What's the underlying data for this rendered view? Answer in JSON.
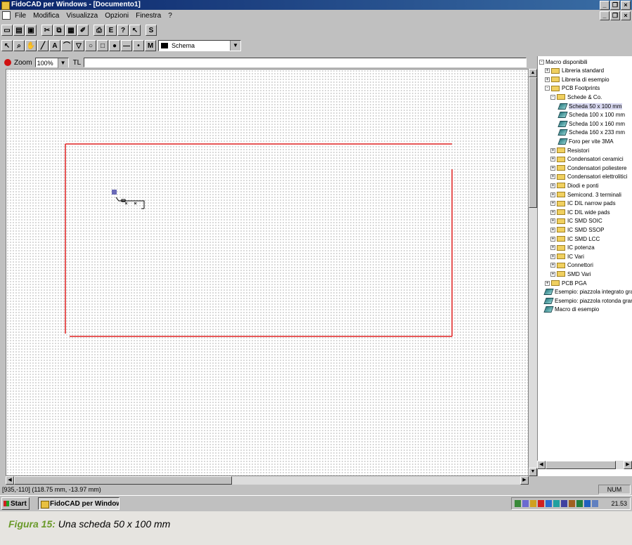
{
  "window": {
    "title": "FidoCAD per Windows - [Documento1]"
  },
  "menu": {
    "items": [
      "File",
      "Modifica",
      "Visualizza",
      "Opzioni",
      "Finestra",
      "?"
    ]
  },
  "toolbar1": {
    "buttons": [
      "new-icon",
      "open-icon",
      "save-icon",
      "cut-icon",
      "copy-icon",
      "paste-icon",
      "eraser-icon",
      "print-icon",
      "export-icon",
      "help-icon",
      "context-help-icon",
      "S"
    ]
  },
  "toolbar2": {
    "buttons": [
      "select-arrow-icon",
      "zoom-magnifier-icon",
      "hand-pan-icon",
      "line-icon",
      "A",
      "curve-icon",
      "polygon-icon",
      "ellipse-icon",
      "rectangle-icon",
      "dot-icon",
      "line-segment-icon",
      "pad-icon",
      "M"
    ],
    "layer": {
      "label": "Schema",
      "color": "#000000"
    }
  },
  "zoombar": {
    "zoom_label": "Zoom",
    "zoom_value": "100%",
    "text_label": "TL",
    "text_value": ""
  },
  "colors": {
    "outline": "#e02020",
    "canvas_dot": "#a8a8a8"
  },
  "tree": {
    "root": "Macro disponibili",
    "nodes": [
      {
        "label": "Libreria standard",
        "type": "folder",
        "expander": "+"
      },
      {
        "label": "Libreria di esempio",
        "type": "folder",
        "expander": "+"
      },
      {
        "label": "PCB Footprints",
        "type": "folder",
        "expander": "-"
      },
      {
        "label": "Schede & Co.",
        "type": "folder",
        "expander": "-"
      },
      {
        "label": "Scheda  50 x 100 mm",
        "type": "macro",
        "selected": true
      },
      {
        "label": "Scheda 100 x 100 mm",
        "type": "macro"
      },
      {
        "label": "Scheda 100 x 160 mm",
        "type": "macro"
      },
      {
        "label": "Scheda 160 x 233 mm",
        "type": "macro"
      },
      {
        "label": "Foro per vite 3MA",
        "type": "macro"
      },
      {
        "label": "Resistori",
        "type": "folder",
        "expander": "+"
      },
      {
        "label": "Condensatori ceramici",
        "type": "folder",
        "expander": "+"
      },
      {
        "label": "Condensatori poliestere",
        "type": "folder",
        "expander": "+"
      },
      {
        "label": "Condensatori elettrolitici",
        "type": "folder",
        "expander": "+"
      },
      {
        "label": "Diodi e ponti",
        "type": "folder",
        "expander": "+"
      },
      {
        "label": "Semicond. 3 terminali",
        "type": "folder",
        "expander": "+"
      },
      {
        "label": "IC DIL narrow pads",
        "type": "folder",
        "expander": "+"
      },
      {
        "label": "IC DIL wide pads",
        "type": "folder",
        "expander": "+"
      },
      {
        "label": "IC SMD SOIC",
        "type": "folder",
        "expander": "+"
      },
      {
        "label": "IC SMD SSOP",
        "type": "folder",
        "expander": "+"
      },
      {
        "label": "IC SMD LCC",
        "type": "folder",
        "expander": "+"
      },
      {
        "label": "IC potenza",
        "type": "folder",
        "expander": "+"
      },
      {
        "label": "IC Vari",
        "type": "folder",
        "expander": "+"
      },
      {
        "label": "Connettori",
        "type": "folder",
        "expander": "+"
      },
      {
        "label": "SMD Vari",
        "type": "folder",
        "expander": "+"
      },
      {
        "label": "PCB PGA",
        "type": "folder",
        "expander": "+"
      },
      {
        "label": "Esempio: piazzola integrato gran",
        "type": "macro"
      },
      {
        "label": "Esempio: piazzola rotonda granc",
        "type": "macro"
      },
      {
        "label": "Macro di esempio",
        "type": "macro"
      }
    ]
  },
  "status": {
    "coords": "[935,-110] (118.75 mm, -13.97 mm)",
    "num": "NUM"
  },
  "taskbar": {
    "start": "Start",
    "task": "FidoCAD per Window...",
    "clock": "21.53"
  },
  "caption": {
    "label": "Figura 15:",
    "text": "Una scheda 50 x 100 mm"
  }
}
